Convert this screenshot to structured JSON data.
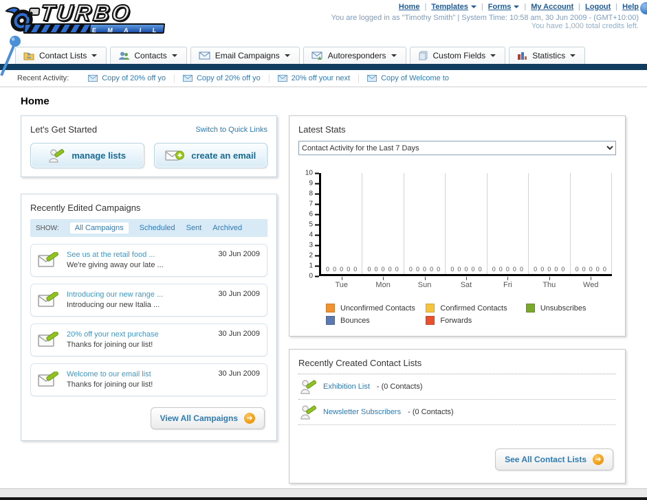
{
  "header": {
    "logo_title": "TURBO",
    "logo_subtitle": "E M A I L",
    "nav_links": [
      {
        "label": "Home",
        "has_menu": false
      },
      {
        "label": "Templates",
        "has_menu": true
      },
      {
        "label": "Forms",
        "has_menu": true
      },
      {
        "label": "My Account",
        "has_menu": false
      },
      {
        "label": "Logout",
        "has_menu": false
      },
      {
        "label": "Help",
        "has_menu": false
      }
    ],
    "status_line1": "You are logged in as \"Timothy Smith\" | System Time: 10:58 am, 30 Jun 2009 - (GMT+10:00)",
    "status_line2": "You have 1,000 total credits left."
  },
  "nav_tabs": [
    {
      "label": "Contact Lists"
    },
    {
      "label": "Contacts"
    },
    {
      "label": "Email Campaigns"
    },
    {
      "label": "Autoresponders"
    },
    {
      "label": "Custom Fields"
    },
    {
      "label": "Statistics"
    }
  ],
  "recent_activity": {
    "label": "Recent Activity:",
    "items": [
      "Copy of 20% off yo",
      "Copy of 20% off yo",
      "20% off your next",
      "Copy of Welcome to"
    ]
  },
  "page_title": "Home",
  "get_started": {
    "title": "Let's Get Started",
    "switch_link": "Switch to Quick Links",
    "manage_lists_label": "manage lists",
    "create_email_label": "create an email"
  },
  "campaigns": {
    "title": "Recently Edited Campaigns",
    "show_label": "SHOW:",
    "filters": [
      "All Campaigns",
      "Scheduled",
      "Sent",
      "Archived"
    ],
    "active_filter": "All Campaigns",
    "items": [
      {
        "title": "See us at the retail food ...",
        "subtitle": "We're giving away our late ...",
        "date": "30 Jun 2009"
      },
      {
        "title": "Introducing our new range ...",
        "subtitle": "Introducing our new Italia ...",
        "date": "30 Jun 2009"
      },
      {
        "title": "20% off your next purchase",
        "subtitle": "Thanks for joining our list!",
        "date": "30 Jun 2009"
      },
      {
        "title": "Welcome to our email list",
        "subtitle": "Thanks for joining our list!",
        "date": "30 Jun 2009"
      }
    ],
    "view_all_label": "View All Campaigns"
  },
  "stats": {
    "title": "Latest Stats",
    "dropdown_value": "Contact Activity for the Last 7 Days"
  },
  "chart_data": {
    "type": "bar",
    "title": "Contact Activity for the Last 7 Days",
    "categories": [
      "Tue",
      "Mon",
      "Sun",
      "Sat",
      "Fri",
      "Thu",
      "Wed"
    ],
    "series": [
      {
        "name": "Unconfirmed Contacts",
        "color": "#f0922f",
        "values": [
          0,
          0,
          0,
          0,
          0,
          0,
          0
        ]
      },
      {
        "name": "Confirmed Contacts",
        "color": "#f6c53d",
        "values": [
          0,
          0,
          0,
          0,
          0,
          0,
          0
        ]
      },
      {
        "name": "Unsubscribes",
        "color": "#7aa82d",
        "values": [
          0,
          0,
          0,
          0,
          0,
          0,
          0
        ]
      },
      {
        "name": "Bounces",
        "color": "#5c78b0",
        "values": [
          0,
          0,
          0,
          0,
          0,
          0,
          0
        ]
      },
      {
        "name": "Forwards",
        "color": "#e9502e",
        "values": [
          0,
          0,
          0,
          0,
          0,
          0,
          0
        ]
      }
    ],
    "xlabel": "",
    "ylabel": "",
    "ylim": [
      0,
      10
    ],
    "yticks": [
      0,
      1,
      2,
      3,
      4,
      5,
      6,
      7,
      8,
      9,
      10
    ],
    "grid": "vertical-only",
    "legend_position": "bottom"
  },
  "contact_lists": {
    "title": "Recently Created Contact Lists",
    "items": [
      {
        "name": "Exhibition List",
        "suffix": "- (0 Contacts)"
      },
      {
        "name": "Newsletter Subscribers",
        "suffix": "- (0 Contacts)"
      }
    ],
    "see_all_label": "See All Contact Lists"
  }
}
